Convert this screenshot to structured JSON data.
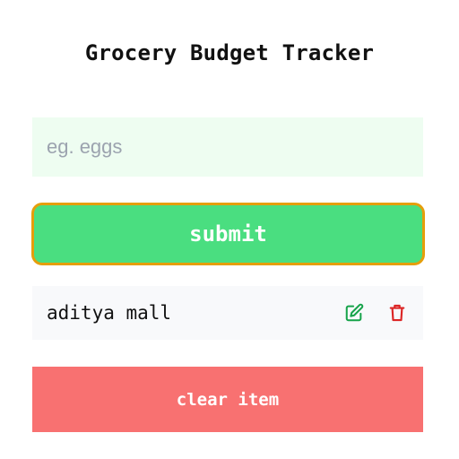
{
  "app": {
    "title": "Grocery Budget Tracker"
  },
  "form": {
    "input_placeholder": "eg. eggs",
    "input_value": "",
    "submit_label": "submit"
  },
  "list": {
    "items": [
      {
        "name": "aditya mall",
        "edit_icon": "edit-icon",
        "delete_icon": "trash-icon"
      }
    ]
  },
  "actions": {
    "clear_label": "clear item"
  },
  "colors": {
    "input_bg": "#eefdf1",
    "submit_bg": "#4ade80",
    "submit_border": "#e59e0b",
    "edit_icon": "#16a34a",
    "delete_icon": "#dc2626",
    "item_bg": "#f8f9fb",
    "clear_bg": "#f87171"
  }
}
